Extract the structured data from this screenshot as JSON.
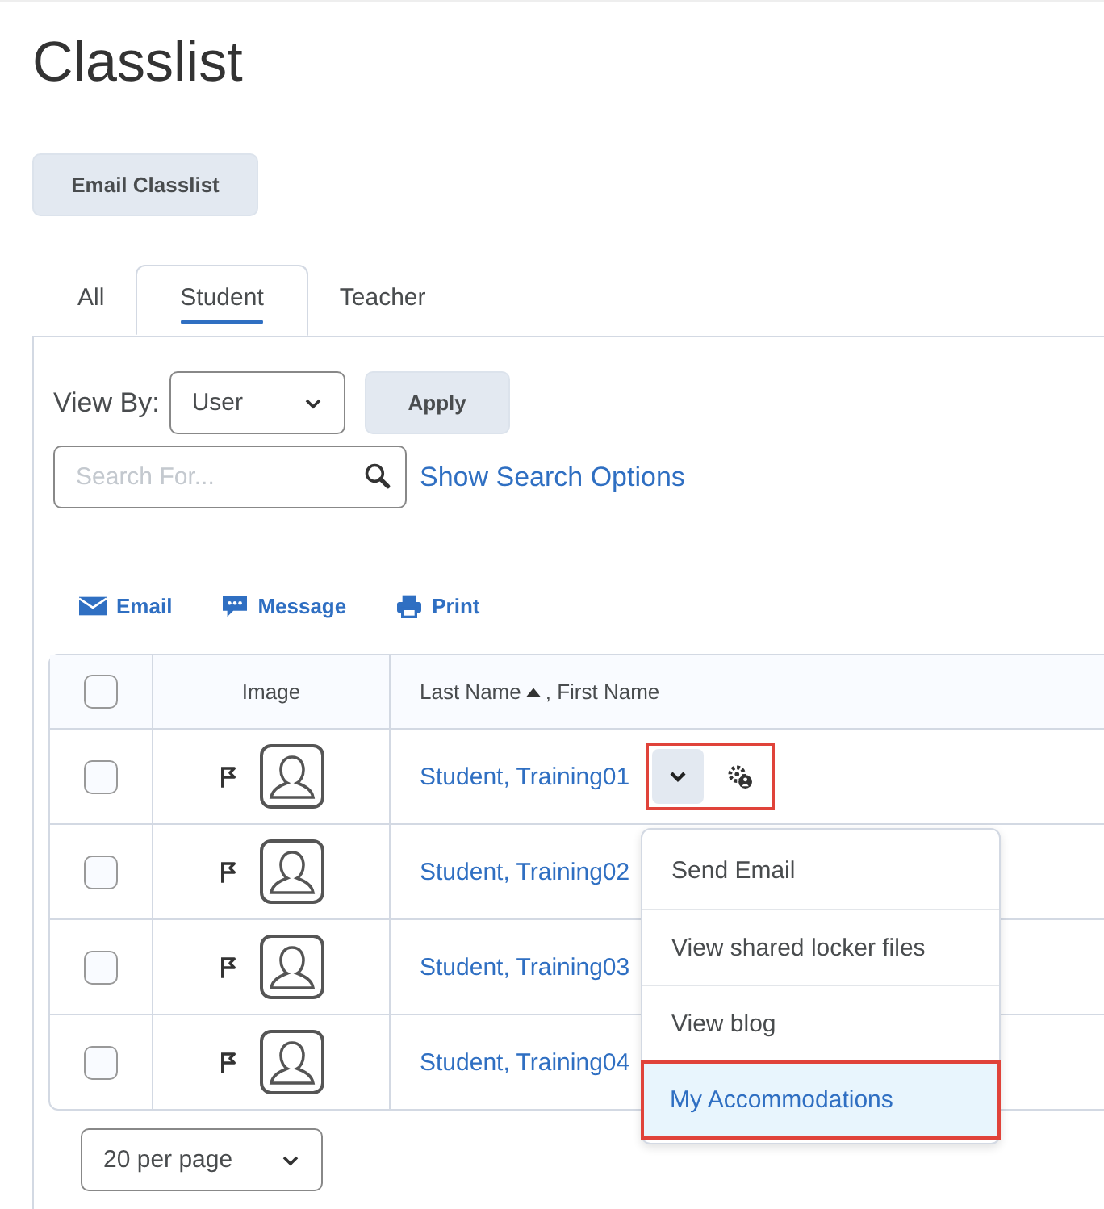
{
  "title": "Classlist",
  "email_button": "Email Classlist",
  "tabs": [
    {
      "label": "All",
      "selected": false
    },
    {
      "label": "Student",
      "selected": true
    },
    {
      "label": "Teacher",
      "selected": false
    }
  ],
  "view_by": {
    "label": "View By:",
    "value": "User",
    "apply": "Apply"
  },
  "search": {
    "placeholder": "Search For...",
    "options_link": "Show Search Options"
  },
  "toolbar": [
    {
      "kind": "email",
      "label": "Email"
    },
    {
      "kind": "message",
      "label": "Message"
    },
    {
      "kind": "print",
      "label": "Print"
    }
  ],
  "table": {
    "columns": [
      "Image",
      "Last Name",
      ", First Name"
    ],
    "header_checked": false,
    "rows": [
      {
        "name": "Student, Training01",
        "checked": false
      },
      {
        "name": "Student, Training02",
        "checked": false
      },
      {
        "name": "Student, Training03",
        "checked": false
      },
      {
        "name": "Student, Training04",
        "checked": false
      }
    ]
  },
  "row_actions": {
    "highlighted": true
  },
  "menu": {
    "items": [
      {
        "label": "Send Email",
        "selected": false
      },
      {
        "label": "View shared locker files",
        "selected": false
      },
      {
        "label": "View blog",
        "selected": false
      },
      {
        "label": "My Accommodations",
        "selected": true
      }
    ]
  },
  "pager": "20 per page"
}
